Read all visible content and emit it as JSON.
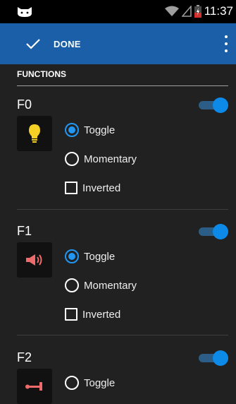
{
  "status_bar": {
    "time": "11:37",
    "icons": [
      "cat-icon",
      "wifi-icon",
      "signal-icon",
      "battery-icon"
    ]
  },
  "action_bar": {
    "done_label": "DONE",
    "done_icon": "check-icon",
    "overflow_icon": "overflow-menu-icon",
    "color": "#1a5fa7"
  },
  "section": {
    "title": "FUNCTIONS"
  },
  "functions": [
    {
      "name": "F0",
      "icon": "lightbulb-icon",
      "enabled": true,
      "mode": "toggle",
      "inverted": false,
      "options": {
        "toggle": "Toggle",
        "momentary": "Momentary",
        "inverted": "Inverted"
      }
    },
    {
      "name": "F1",
      "icon": "horn-icon",
      "enabled": true,
      "mode": "toggle",
      "inverted": false,
      "options": {
        "toggle": "Toggle",
        "momentary": "Momentary",
        "inverted": "Inverted"
      }
    },
    {
      "name": "F2",
      "icon": "coupler-icon",
      "enabled": true,
      "mode": "toggle",
      "options": {
        "toggle": "Toggle"
      }
    }
  ],
  "colors": {
    "accent": "#2196f3",
    "background": "#212121"
  }
}
